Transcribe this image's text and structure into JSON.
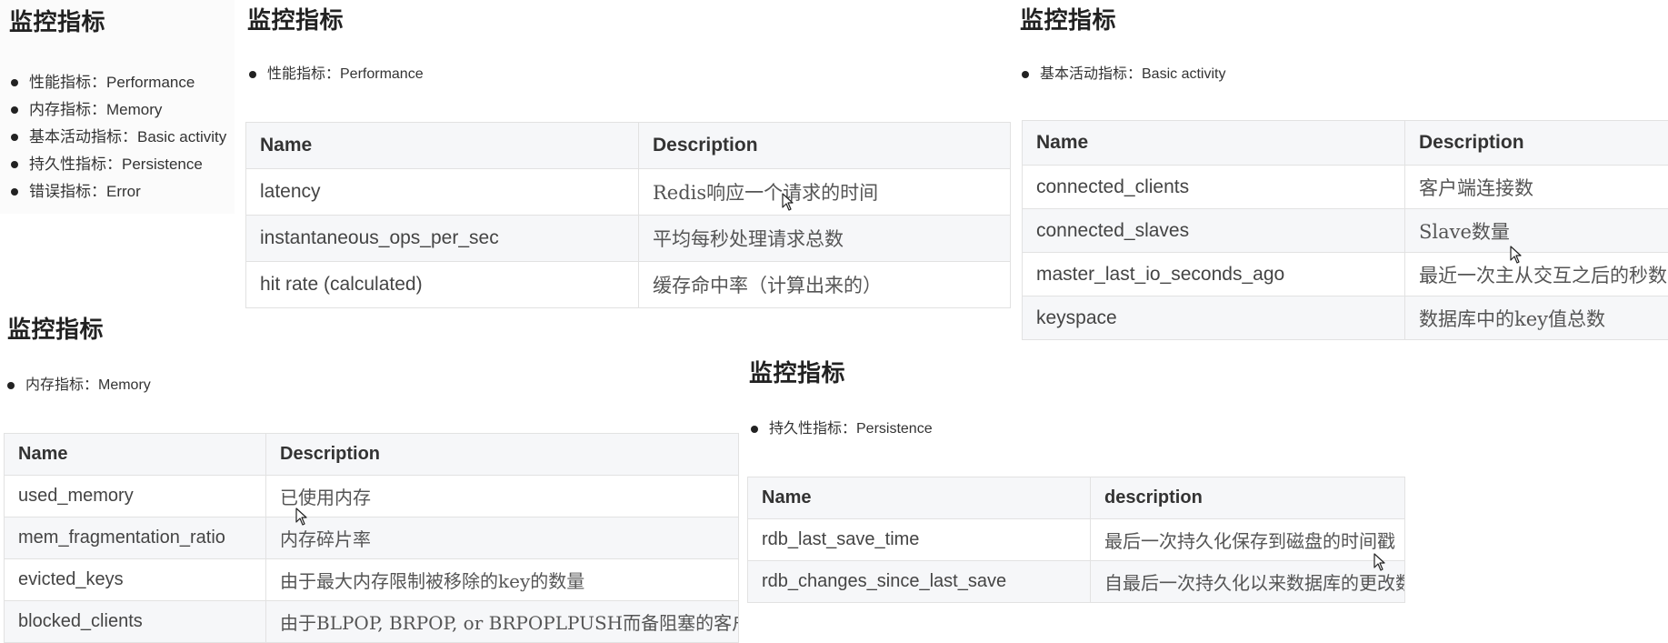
{
  "panel_overview": {
    "title": "监控指标",
    "items": [
      "性能指标：Performance",
      "内存指标：Memory",
      "基本活动指标：Basic activity",
      "持久性指标：Persistence",
      "错误指标：Error"
    ]
  },
  "panel_performance": {
    "title": "监控指标",
    "bullet": "性能指标：Performance",
    "headers": [
      "Name",
      "Description"
    ],
    "rows": [
      [
        "latency",
        "Redis响应一个请求的时间"
      ],
      [
        "instantaneous_ops_per_sec",
        "平均每秒处理请求总数"
      ],
      [
        "hit rate (calculated)",
        "缓存命中率（计算出来的）"
      ]
    ]
  },
  "panel_basic_activity": {
    "title": "监控指标",
    "bullet": "基本活动指标：Basic activity",
    "headers": [
      "Name",
      "Description"
    ],
    "rows": [
      [
        "connected_clients",
        "客户端连接数"
      ],
      [
        "connected_slaves",
        "Slave数量"
      ],
      [
        "master_last_io_seconds_ago",
        "最近一次主从交互之后的秒数"
      ],
      [
        "keyspace",
        "数据库中的key值总数"
      ]
    ]
  },
  "panel_memory": {
    "title": "监控指标",
    "bullet": "内存指标：Memory",
    "headers": [
      "Name",
      "Description"
    ],
    "rows": [
      [
        "used_memory",
        "已使用内存"
      ],
      [
        "mem_fragmentation_ratio",
        "内存碎片率"
      ],
      [
        "evicted_keys",
        "由于最大内存限制被移除的key的数量"
      ],
      [
        "blocked_clients",
        "由于BLPOP, BRPOP, or BRPOPLPUSH而备阻塞的客户端"
      ]
    ]
  },
  "panel_persistence": {
    "title": "监控指标",
    "bullet": "持久性指标：Persistence",
    "headers": [
      "Name",
      "description"
    ],
    "rows": [
      [
        "rdb_last_save_time",
        "最后一次持久化保存到磁盘的时间戳"
      ],
      [
        "rdb_changes_since_last_save",
        "自最后一次持久化以来数据库的更改数"
      ]
    ]
  },
  "icons": {
    "cursor": "mouse-pointer-icon"
  }
}
